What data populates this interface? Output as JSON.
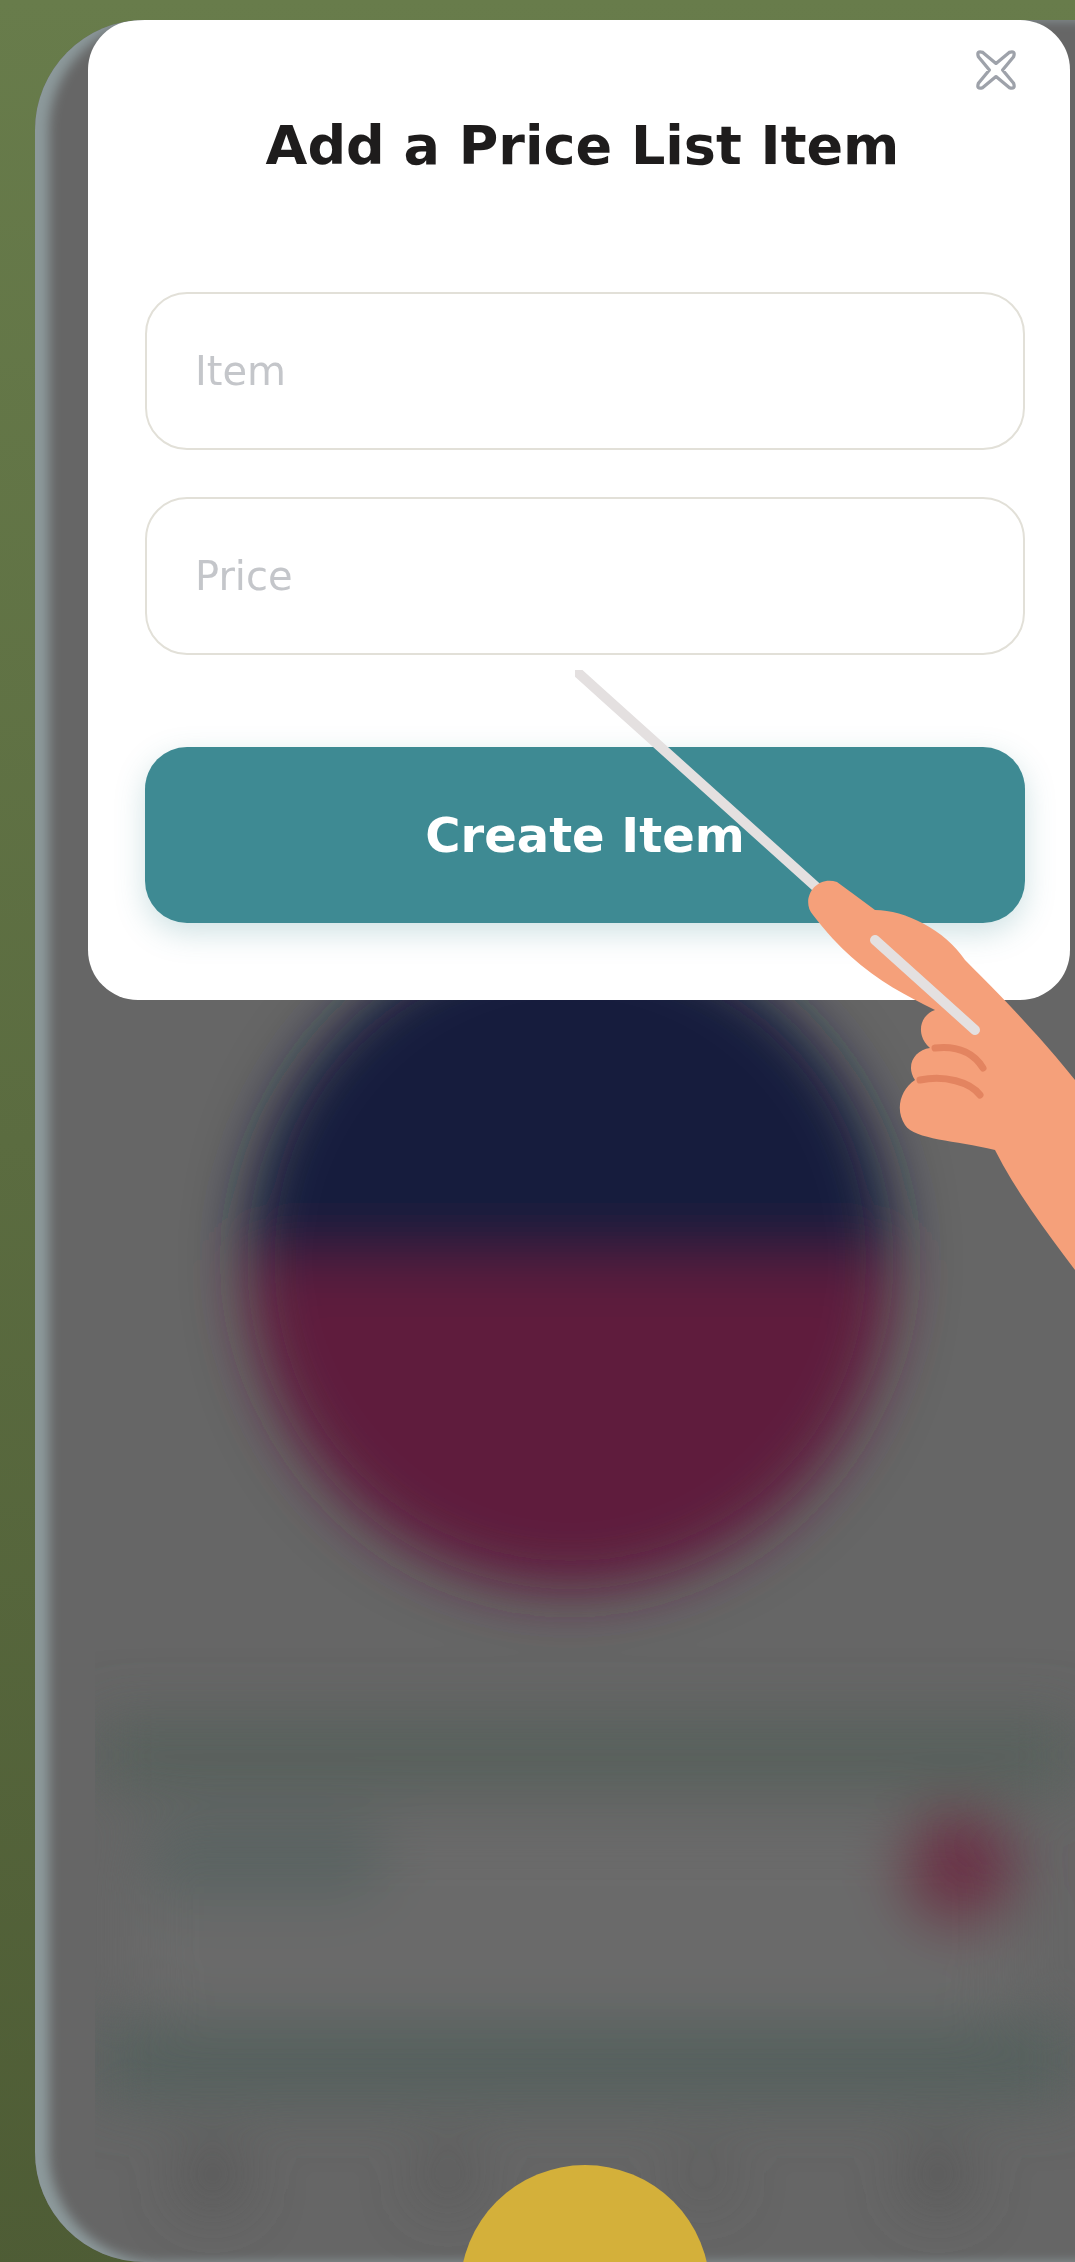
{
  "dialog": {
    "title": "Add a Price List Item",
    "fields": [
      {
        "placeholder": "Item"
      },
      {
        "placeholder": "Price"
      }
    ],
    "button": "Create Item"
  }
}
